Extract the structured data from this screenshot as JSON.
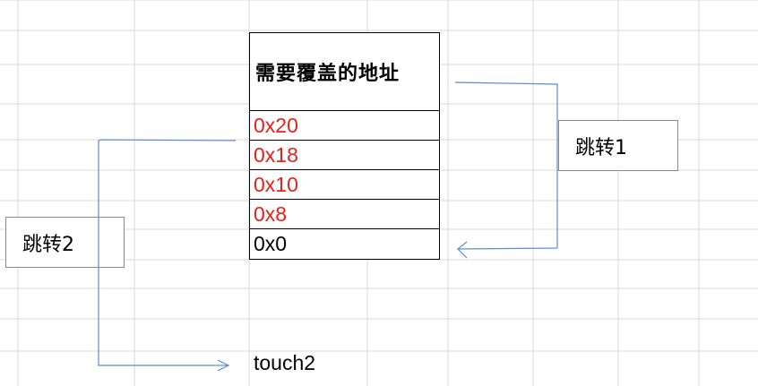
{
  "table": {
    "header": "需要覆盖的地址",
    "rows": [
      {
        "text": "0x20",
        "color": "#e8201a"
      },
      {
        "text": "0x18",
        "color": "#e8201a"
      },
      {
        "text": "0x10",
        "color": "#e8201a"
      },
      {
        "text": "0x8",
        "color": "#e8201a"
      },
      {
        "text": "0x0",
        "color": "#000000"
      }
    ]
  },
  "boxes": {
    "jump1": "跳转1",
    "jump2": "跳转2"
  },
  "target_label": "touch2",
  "colors": {
    "arrow": "#5b8fd0",
    "grid": "#d9d9d9",
    "highlight": "#e8201a"
  }
}
